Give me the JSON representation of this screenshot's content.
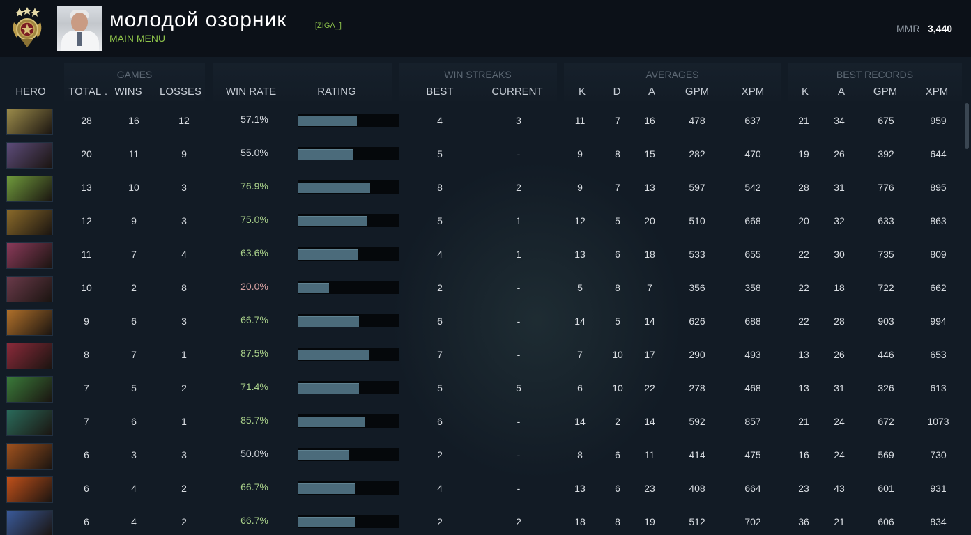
{
  "player": {
    "name": "молодой озорник",
    "tag": "[ZIGA_]",
    "main_menu": "MAIN MENU",
    "mmr_label": "MMR",
    "mmr_value": "3,440",
    "rank_medal_icon": "rank-medal-icon",
    "avatar_icon": "player-avatar"
  },
  "groups": {
    "games": "GAMES",
    "win_streaks": "WIN STREAKS",
    "averages": "AVERAGES",
    "best_records": "BEST RECORDS"
  },
  "columns": {
    "hero": "HERO",
    "total": "TOTAL",
    "wins": "WINS",
    "losses": "LOSSES",
    "win_rate": "WIN RATE",
    "rating": "RATING",
    "best": "BEST",
    "current": "CURRENT",
    "k": "K",
    "d": "D",
    "a": "A",
    "gpm": "GPM",
    "xpm": "XPM",
    "best_k": "K",
    "best_a": "A",
    "best_gpm": "GPM",
    "best_xpm": "XPM"
  },
  "colors": {
    "winrate_good": "#a9d08a",
    "winrate_neutral": "#d9dde2",
    "winrate_bad": "#d9a3a3",
    "accent_green": "#8dc24a",
    "rating_bar": "#4b6b7b"
  },
  "rows": [
    {
      "hero_color": "#9a8a4a",
      "total": "28",
      "wins": "16",
      "losses": "12",
      "win_rate": "57.1%",
      "wr_tone": "neutral",
      "rating": 0.58,
      "best": "4",
      "current": "3",
      "k": "11",
      "d": "7",
      "a": "16",
      "gpm": "478",
      "xpm": "637",
      "bk": "21",
      "ba": "34",
      "bgpm": "675",
      "bxpm": "959"
    },
    {
      "hero_color": "#5d4c7a",
      "total": "20",
      "wins": "11",
      "losses": "9",
      "win_rate": "55.0%",
      "wr_tone": "neutral",
      "rating": 0.55,
      "best": "5",
      "current": "-",
      "k": "9",
      "d": "8",
      "a": "15",
      "gpm": "282",
      "xpm": "470",
      "bk": "19",
      "ba": "26",
      "bgpm": "392",
      "bxpm": "644"
    },
    {
      "hero_color": "#6f9a3c",
      "total": "13",
      "wins": "10",
      "losses": "3",
      "win_rate": "76.9%",
      "wr_tone": "good",
      "rating": 0.71,
      "best": "8",
      "current": "2",
      "k": "9",
      "d": "7",
      "a": "13",
      "gpm": "597",
      "xpm": "542",
      "bk": "28",
      "ba": "31",
      "bgpm": "776",
      "bxpm": "895"
    },
    {
      "hero_color": "#8a6a2a",
      "total": "12",
      "wins": "9",
      "losses": "3",
      "win_rate": "75.0%",
      "wr_tone": "good",
      "rating": 0.68,
      "best": "5",
      "current": "1",
      "k": "12",
      "d": "5",
      "a": "20",
      "gpm": "510",
      "xpm": "668",
      "bk": "20",
      "ba": "32",
      "bgpm": "633",
      "bxpm": "863"
    },
    {
      "hero_color": "#8a3a5a",
      "total": "11",
      "wins": "7",
      "losses": "4",
      "win_rate": "63.6%",
      "wr_tone": "good",
      "rating": 0.59,
      "best": "4",
      "current": "1",
      "k": "13",
      "d": "6",
      "a": "18",
      "gpm": "533",
      "xpm": "655",
      "bk": "22",
      "ba": "30",
      "bgpm": "735",
      "bxpm": "809"
    },
    {
      "hero_color": "#6a3a4a",
      "total": "10",
      "wins": "2",
      "losses": "8",
      "win_rate": "20.0%",
      "wr_tone": "bad",
      "rating": 0.31,
      "best": "2",
      "current": "-",
      "k": "5",
      "d": "8",
      "a": "7",
      "gpm": "356",
      "xpm": "358",
      "bk": "22",
      "ba": "18",
      "bgpm": "722",
      "bxpm": "662"
    },
    {
      "hero_color": "#b0702a",
      "total": "9",
      "wins": "6",
      "losses": "3",
      "win_rate": "66.7%",
      "wr_tone": "good",
      "rating": 0.6,
      "best": "6",
      "current": "-",
      "k": "14",
      "d": "5",
      "a": "14",
      "gpm": "626",
      "xpm": "688",
      "bk": "22",
      "ba": "28",
      "bgpm": "903",
      "bxpm": "994"
    },
    {
      "hero_color": "#8a2a3a",
      "total": "8",
      "wins": "7",
      "losses": "1",
      "win_rate": "87.5%",
      "wr_tone": "good",
      "rating": 0.7,
      "best": "7",
      "current": "-",
      "k": "7",
      "d": "10",
      "a": "17",
      "gpm": "290",
      "xpm": "493",
      "bk": "13",
      "ba": "26",
      "bgpm": "446",
      "bxpm": "653"
    },
    {
      "hero_color": "#3a7a3a",
      "total": "7",
      "wins": "5",
      "losses": "2",
      "win_rate": "71.4%",
      "wr_tone": "good",
      "rating": 0.6,
      "best": "5",
      "current": "5",
      "k": "6",
      "d": "10",
      "a": "22",
      "gpm": "278",
      "xpm": "468",
      "bk": "13",
      "ba": "31",
      "bgpm": "326",
      "bxpm": "613"
    },
    {
      "hero_color": "#2a6a5a",
      "total": "7",
      "wins": "6",
      "losses": "1",
      "win_rate": "85.7%",
      "wr_tone": "good",
      "rating": 0.66,
      "best": "6",
      "current": "-",
      "k": "14",
      "d": "2",
      "a": "14",
      "gpm": "592",
      "xpm": "857",
      "bk": "21",
      "ba": "24",
      "bgpm": "672",
      "bxpm": "1073"
    },
    {
      "hero_color": "#a0521e",
      "total": "6",
      "wins": "3",
      "losses": "3",
      "win_rate": "50.0%",
      "wr_tone": "neutral",
      "rating": 0.5,
      "best": "2",
      "current": "-",
      "k": "8",
      "d": "6",
      "a": "11",
      "gpm": "414",
      "xpm": "475",
      "bk": "16",
      "ba": "24",
      "bgpm": "569",
      "bxpm": "730"
    },
    {
      "hero_color": "#c0501a",
      "total": "6",
      "wins": "4",
      "losses": "2",
      "win_rate": "66.7%",
      "wr_tone": "good",
      "rating": 0.57,
      "best": "4",
      "current": "-",
      "k": "13",
      "d": "6",
      "a": "23",
      "gpm": "408",
      "xpm": "664",
      "bk": "23",
      "ba": "43",
      "bgpm": "601",
      "bxpm": "931"
    },
    {
      "hero_color": "#3a5a9a",
      "total": "6",
      "wins": "4",
      "losses": "2",
      "win_rate": "66.7%",
      "wr_tone": "good",
      "rating": 0.57,
      "best": "2",
      "current": "2",
      "k": "18",
      "d": "8",
      "a": "19",
      "gpm": "512",
      "xpm": "702",
      "bk": "36",
      "ba": "21",
      "bgpm": "606",
      "bxpm": "834"
    }
  ]
}
